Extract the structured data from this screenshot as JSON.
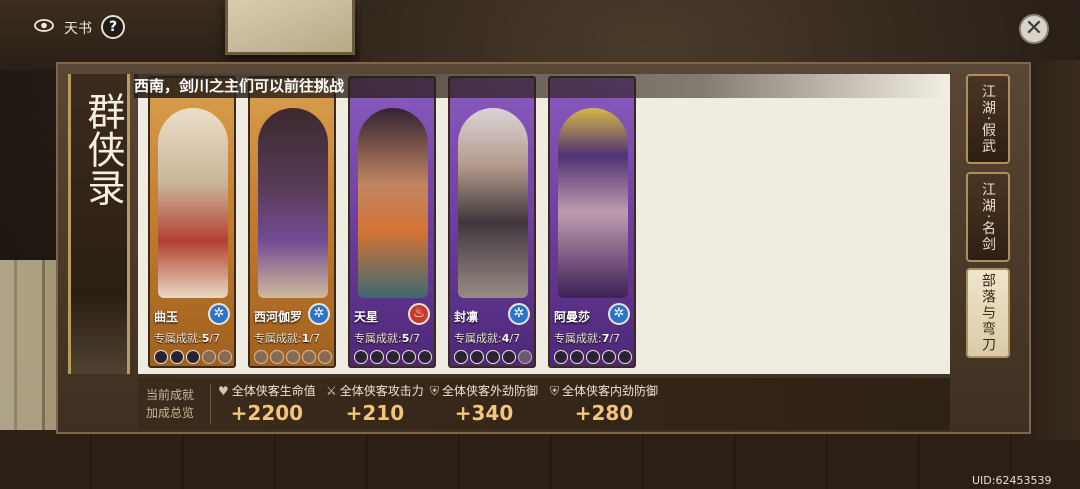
{
  "top": {
    "title": "天书",
    "help": "?",
    "close": "✕"
  },
  "panel": {
    "title": "群侠录",
    "banner": "西南，剑川之主们可以前往挑战"
  },
  "cards": [
    {
      "name": "曲玉",
      "ach_label": "专属成就:",
      "ach_done": "5",
      "ach_total": "/7",
      "color": "orange",
      "badge": "blue"
    },
    {
      "name": "西河伽罗",
      "ach_label": "专属成就:",
      "ach_done": "1",
      "ach_total": "/7",
      "color": "orange",
      "badge": "blue"
    },
    {
      "name": "天星",
      "ach_label": "专属成就:",
      "ach_done": "5",
      "ach_total": "/7",
      "color": "purple",
      "badge": "red"
    },
    {
      "name": "封凛",
      "ach_label": "专属成就:",
      "ach_done": "4",
      "ach_total": "/7",
      "color": "purple",
      "badge": "blue"
    },
    {
      "name": "阿曼莎",
      "ach_label": "专属成就:",
      "ach_done": "7",
      "ach_total": "/7",
      "color": "purple",
      "badge": "blue"
    }
  ],
  "tabs": [
    {
      "label": "江湖·假武"
    },
    {
      "label": "江湖·名剑"
    },
    {
      "label": "部落与弯刀"
    }
  ],
  "bonus": {
    "label_line1": "当前成就",
    "label_line2": "加成总览",
    "items": [
      {
        "name": "全体侠客生命值",
        "value": "+2200",
        "icon": "heart-icon"
      },
      {
        "name": "全体侠客攻击力",
        "value": "+210",
        "icon": "sword-icon"
      },
      {
        "name": "全体侠客外劲防御",
        "value": "+340",
        "icon": "shield-icon"
      },
      {
        "name": "全体侠客内劲防御",
        "value": "+280",
        "icon": "shield-icon"
      }
    ]
  },
  "uid": "UID:62453539"
}
